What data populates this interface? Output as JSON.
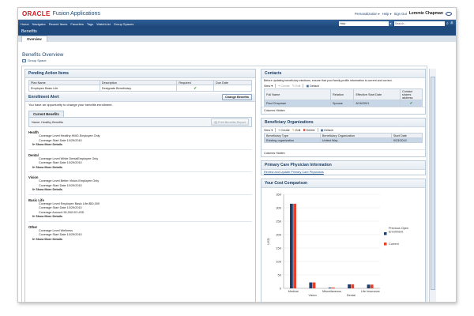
{
  "brand": {
    "logo": "ORACLE",
    "product": "Fusion Applications",
    "links": [
      "Personalization ▾",
      "Help ▾",
      "Sign Out"
    ],
    "user": "Lemmie Chapman"
  },
  "navbar": {
    "items": [
      "Home",
      "Navigator",
      "Recent Items",
      "Favorites",
      "Tags",
      "WatchList",
      "Group Spaces"
    ],
    "help_select": "Help",
    "search_placeholder": "Search..."
  },
  "title": "Benefits",
  "tab": "Overview",
  "page_title": "Benefits Overview",
  "group_space": "Group Space",
  "pending": {
    "title": "Pending Action Items",
    "headers": [
      "Plan Name",
      "Description",
      "Required",
      "Due Date"
    ],
    "rows": [
      [
        "Employee Basic Life",
        "Designate Beneficiary.",
        "",
        ""
      ]
    ]
  },
  "enrollment": {
    "title": "Enrollment Alert",
    "button": "Change Benefits",
    "message": "You have an opportunity to change your benefits enrollment."
  },
  "current": {
    "tab": "Current Benefits",
    "name": "Name: Healthy Benefits",
    "print": "Print Benefits Report",
    "show_more": "⊳ Show More Details",
    "groups": [
      {
        "title": "Health",
        "lines": [
          "Coverage Level Healthy HMO-Employee Only",
          "Coverage Start Date 10/29/2010"
        ]
      },
      {
        "title": "Dental",
        "lines": [
          "Coverage Level White DentalEmployee Only",
          "Coverage Start Date 10/29/2010"
        ]
      },
      {
        "title": "Vision",
        "lines": [
          "Coverage Level Better Vision-Employee Only",
          "Coverage Start Date 10/29/2010"
        ]
      },
      {
        "title": "Basic Life",
        "lines": [
          "Coverage Level Employee Basic Life-$50,000",
          "Coverage Start Date 10/29/2010",
          "Coverage Amount 50,000.00 USD"
        ]
      },
      {
        "title": "Other",
        "lines": [
          "Coverage Level Wellness",
          "Coverage Start Date 10/29/2010"
        ]
      }
    ]
  },
  "contacts": {
    "title": "Contacts",
    "desc": "Before updating beneficiary elections, ensure that your family profile information is current and correct.",
    "toolbar": {
      "view": "View ▾",
      "create": "Create",
      "edit": "Edit",
      "detach": "Detach"
    },
    "headers": [
      "Full Name",
      "Relation",
      "Effective Start Date",
      "Contact shares address"
    ],
    "rows": [
      [
        "Paul Chapman",
        "Spouse",
        "8/16/2001",
        ""
      ]
    ],
    "columns_hidden": "Columns Hidden"
  },
  "beneficiary": {
    "title": "Beneficiary Organizations",
    "toolbar": {
      "view": "View ▾",
      "create": "Create",
      "edit": "Edit",
      "delete": "Delete",
      "detach": "Detach"
    },
    "headers": [
      "Beneficiary Type",
      "Beneficiary Organization",
      "Start Date"
    ],
    "rows": [
      [
        "Existing organization",
        "United Way",
        "9/23/2010"
      ]
    ],
    "columns_hidden": "Columns Hidden"
  },
  "pcp": {
    "title": "Primary Care Physician Information",
    "link": "Review and Update Primary Care Physicians"
  },
  "cost": {
    "title": "Your Cost Comparison"
  },
  "colors": {
    "previous": "#1f3f6b",
    "current": "#e8402a",
    "navbar": "#24558c",
    "title": "#1e4a7d"
  },
  "chart_data": {
    "type": "bar",
    "title": "Your Cost Comparison",
    "categories": [
      "Medical",
      "Vision",
      "Miscellaneous",
      "Dental",
      "Life Insurance"
    ],
    "series": [
      {
        "name": "Previous Open Enrollment",
        "values": [
          315,
          22,
          3,
          15,
          14
        ]
      },
      {
        "name": "Current",
        "values": [
          315,
          22,
          3,
          15,
          14
        ]
      }
    ],
    "ylabel": "USD",
    "ylim": [
      0,
      350
    ],
    "yticks": [
      0,
      50,
      100,
      150,
      200,
      250,
      300,
      350
    ],
    "legend": "right"
  }
}
